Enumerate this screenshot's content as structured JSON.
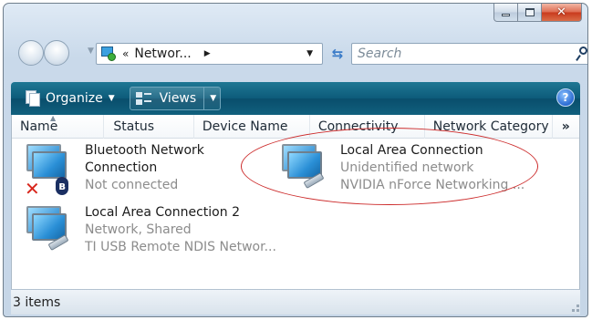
{
  "window": {
    "caption_buttons": {
      "minimize": "minimize",
      "maximize": "maximize",
      "close": "✕"
    }
  },
  "navigation": {
    "address_prefix": "«",
    "address_text": "Networ...",
    "address_arrow": "▶",
    "search_placeholder": "Search"
  },
  "toolbar": {
    "organize_label": "Organize",
    "views_label": "Views",
    "help_label": "?"
  },
  "columns": [
    "Name",
    "Status",
    "Device Name",
    "Connectivity",
    "Network Category",
    "»"
  ],
  "items": [
    {
      "title_line1": "Bluetooth Network",
      "title_line2": "Connection",
      "status": "Not connected",
      "icons": [
        "network-adapter-icon",
        "red-x-icon",
        "bluetooth-icon"
      ]
    },
    {
      "title": "Local Area Connection",
      "status": "Unidentified network",
      "device": "NVIDIA nForce Networking ...",
      "highlighted": true
    },
    {
      "title": "Local Area Connection 2",
      "status": "Network, Shared",
      "device": "TI USB Remote NDIS Networ..."
    }
  ],
  "statusbar": {
    "count_text": "3 items"
  },
  "colors": {
    "toolbar": "#0d5b7a",
    "annotation": "#cc2a2a",
    "secondary_text": "#8c8c8c"
  }
}
